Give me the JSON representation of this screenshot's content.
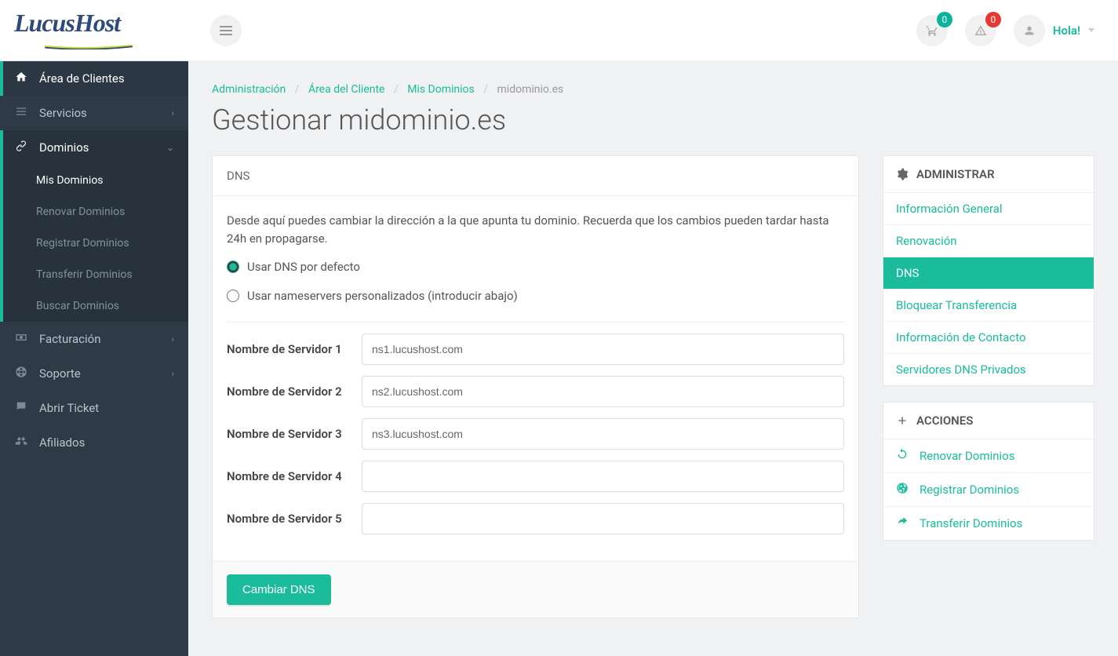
{
  "brand": {
    "name": "LucusHost"
  },
  "topbar": {
    "cart_badge": "0",
    "alert_badge": "0",
    "greeting": "Hola!"
  },
  "sidebar": {
    "items": [
      {
        "label": "Área de Clientes",
        "active": true
      },
      {
        "label": "Servicios",
        "chevron": true
      },
      {
        "label": "Dominios",
        "chevron": true,
        "expanded": true,
        "children": [
          {
            "label": "Mis Dominios",
            "active": true
          },
          {
            "label": "Renovar Dominios"
          },
          {
            "label": "Registrar Dominios"
          },
          {
            "label": "Transferir Dominios"
          },
          {
            "label": "Buscar Dominios"
          }
        ]
      },
      {
        "label": "Facturación",
        "chevron": true
      },
      {
        "label": "Soporte",
        "chevron": true
      },
      {
        "label": "Abrir Ticket"
      },
      {
        "label": "Afiliados"
      }
    ]
  },
  "breadcrumb": {
    "items": [
      {
        "label": "Administración",
        "link": true
      },
      {
        "label": "Área del Cliente",
        "link": true
      },
      {
        "label": "Mis Dominios",
        "link": true
      },
      {
        "label": "midominio.es",
        "link": false
      }
    ]
  },
  "page_title": "Gestionar midominio.es",
  "dns_card": {
    "title": "DNS",
    "description": "Desde aquí puedes cambiar la dirección a la que apunta tu dominio. Recuerda que los cambios pueden tardar hasta 24h en propagarse.",
    "radios": [
      {
        "label": "Usar DNS por defecto",
        "checked": true
      },
      {
        "label": "Usar nameservers personalizados (introducir abajo)",
        "checked": false
      }
    ],
    "fields": [
      {
        "label": "Nombre de Servidor 1",
        "value": "ns1.lucushost.com"
      },
      {
        "label": "Nombre de Servidor 2",
        "value": "ns2.lucushost.com"
      },
      {
        "label": "Nombre de Servidor 3",
        "value": "ns3.lucushost.com"
      },
      {
        "label": "Nombre de Servidor 4",
        "value": ""
      },
      {
        "label": "Nombre de Servidor 5",
        "value": ""
      }
    ],
    "submit_label": "Cambiar DNS"
  },
  "admin_panel": {
    "title": "ADMINISTRAR",
    "items": [
      {
        "label": "Información General"
      },
      {
        "label": "Renovación"
      },
      {
        "label": "DNS",
        "active": true
      },
      {
        "label": "Bloquear Transferencia"
      },
      {
        "label": "Información de Contacto"
      },
      {
        "label": "Servidores DNS Privados"
      }
    ]
  },
  "actions_panel": {
    "title": "ACCIONES",
    "items": [
      {
        "label": "Renovar Dominios",
        "icon": "refresh"
      },
      {
        "label": "Registrar Dominios",
        "icon": "globe"
      },
      {
        "label": "Transferir Dominios",
        "icon": "share"
      }
    ]
  }
}
